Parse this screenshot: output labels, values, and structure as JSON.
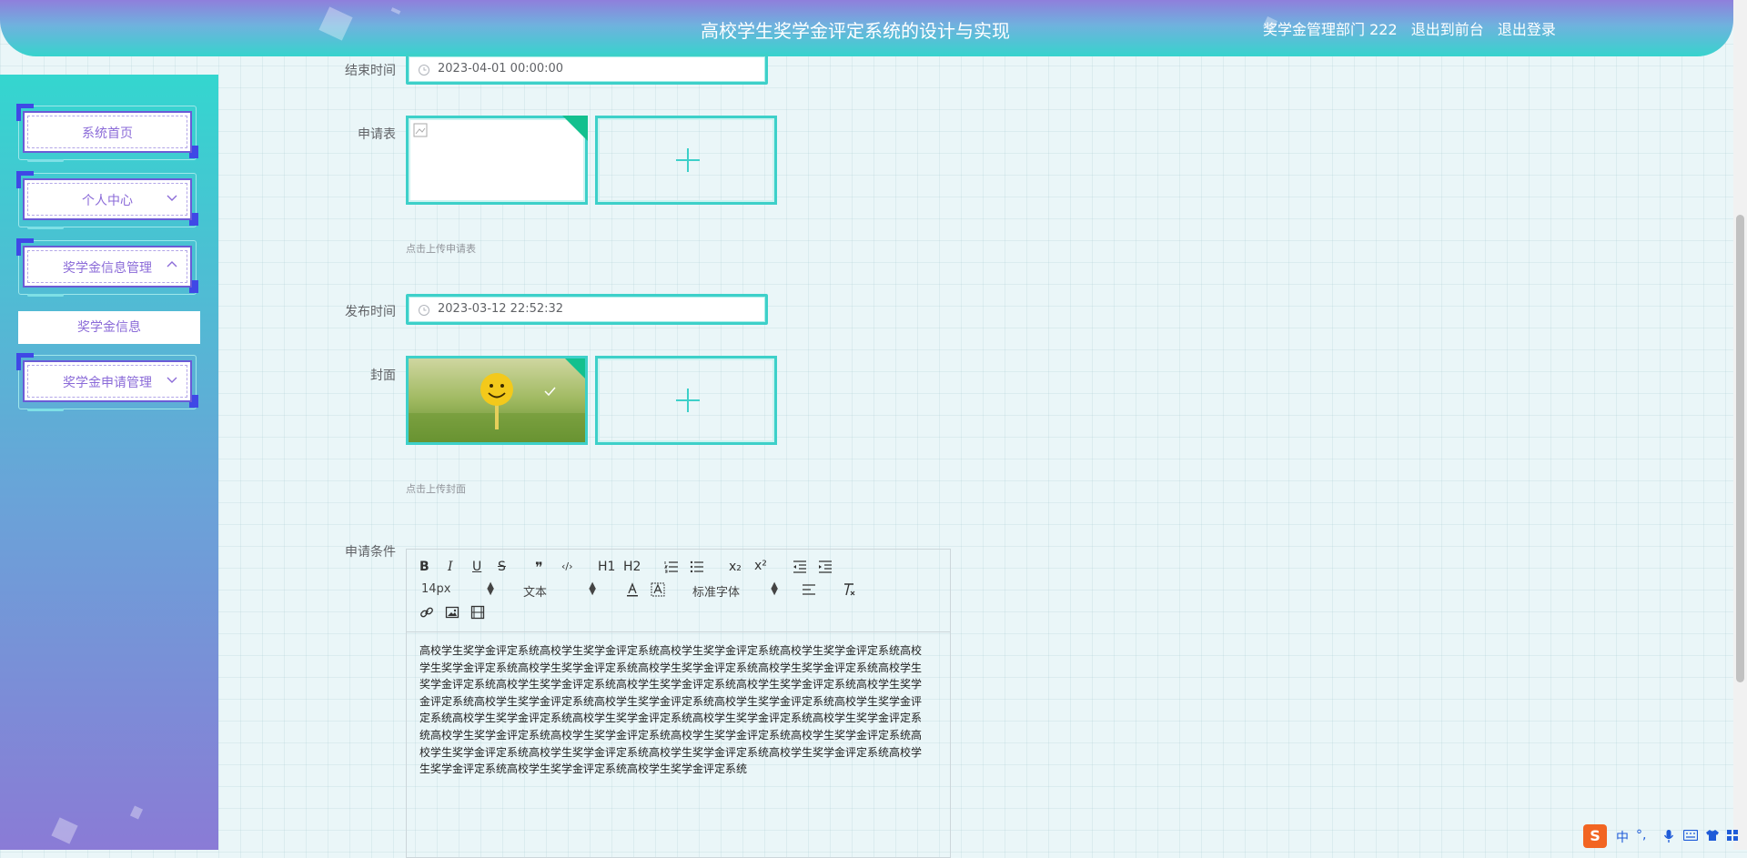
{
  "header": {
    "title": "高校学生奖学金评定系统的设计与实现",
    "user": "奖学金管理部门 222",
    "link_front": "退出到前台",
    "link_logout": "退出登录"
  },
  "sidebar": {
    "items": [
      {
        "label": "系统首页"
      },
      {
        "label": "个人中心"
      },
      {
        "label": "奖学金信息管理"
      },
      {
        "label": "奖学金申请管理"
      }
    ],
    "submenu_active": "奖学金信息"
  },
  "form": {
    "end_time": {
      "label": "结束时间",
      "value": "2023-04-01 00:00:00"
    },
    "application_form": {
      "label": "申请表",
      "hint": "点击上传申请表"
    },
    "publish_time": {
      "label": "发布时间",
      "value": "2023-03-12 22:52:32"
    },
    "cover": {
      "label": "封面",
      "hint": "点击上传封面"
    },
    "conditions": {
      "label": "申请条件"
    }
  },
  "editor": {
    "toolbar": {
      "bold": "B",
      "italic": "I",
      "underline": "U",
      "strike": "S",
      "quote": "❞",
      "code": "‹/›",
      "h1": "H1",
      "h2": "H2",
      "subscript": "x₂",
      "superscript": "x²",
      "size": "14px",
      "header": "文本",
      "font": "标准字体"
    },
    "content": "高校学生奖学金评定系统高校学生奖学金评定系统高校学生奖学金评定系统高校学生奖学金评定系统高校学生奖学金评定系统高校学生奖学金评定系统高校学生奖学金评定系统高校学生奖学金评定系统高校学生奖学金评定系统高校学生奖学金评定系统高校学生奖学金评定系统高校学生奖学金评定系统高校学生奖学金评定系统高校学生奖学金评定系统高校学生奖学金评定系统高校学生奖学金评定系统高校学生奖学金评定系统高校学生奖学金评定系统高校学生奖学金评定系统高校学生奖学金评定系统高校学生奖学金评定系统高校学生奖学金评定系统高校学生奖学金评定系统高校学生奖学金评定系统高校学生奖学金评定系统高校学生奖学金评定系统高校学生奖学金评定系统高校学生奖学金评定系统高校学生奖学金评定系统高校学生奖学金评定系统高校学生奖学金评定系统高校学生奖学金评定系统"
  },
  "ime": {
    "cn": "中",
    "punct": "°,"
  },
  "colors": {
    "accent": "#3dd0c9",
    "purple": "#8b6bd8",
    "flag": "#13c08e"
  }
}
